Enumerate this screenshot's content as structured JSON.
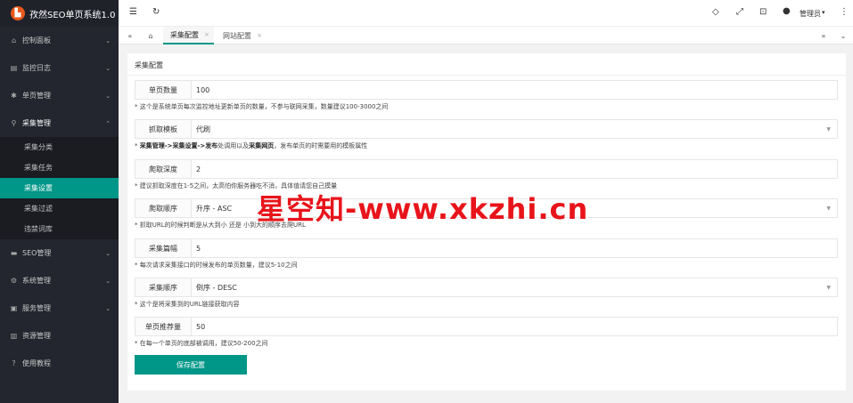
{
  "app": {
    "title": "孜然SEO单页系统1.0"
  },
  "sidebar": {
    "items": [
      {
        "label": "控制面板",
        "icon": "home-icon"
      },
      {
        "label": "监控日志",
        "icon": "log-icon"
      },
      {
        "label": "单页管理",
        "icon": "page-icon"
      },
      {
        "label": "采集管理",
        "icon": "link-icon"
      },
      {
        "label": "SEO管理",
        "icon": "seo-icon"
      },
      {
        "label": "系统管理",
        "icon": "gear-icon"
      },
      {
        "label": "服务管理",
        "icon": "server-icon"
      },
      {
        "label": "资源管理",
        "icon": "resource-icon"
      },
      {
        "label": "使用教程",
        "icon": "help-icon"
      }
    ],
    "subitems": [
      "采集分类",
      "采集任务",
      "采集设置",
      "采集过滤",
      "违禁词库"
    ]
  },
  "topbar": {
    "user": "管理员"
  },
  "tabs": [
    "采集配置",
    "网站配置"
  ],
  "panel": {
    "title": "采集配置",
    "rows": [
      {
        "label": "单页数量",
        "value": "100",
        "hint": "* 这个是系统单页每次监控地址更新单页的数量，不参与联网采集，数量建议100-3000之间"
      },
      {
        "label": "抓取模板",
        "value": "代刷",
        "hint_bold1": "采集管理->采集设置->发布",
        "hint_mid": "处调用以及",
        "hint_bold2": "采集网页",
        "hint_end": "，发布单页的时需要用的模板属性"
      },
      {
        "label": "爬取深度",
        "value": "2",
        "hint": "* 建议抓取深度在1-5之间，太高怕你服务器吃不消，具体值请您自己摸量"
      },
      {
        "label": "爬取顺序",
        "value": "升序 - ASC",
        "hint": "* 抓取URL的时候判断是从大到小 还是 小到大的顺序去爬URL"
      },
      {
        "label": "采集篇幅",
        "value": "5",
        "hint": "* 每次请求采集接口的时候发布的单页数量，建议5-10之间"
      },
      {
        "label": "采集顺序",
        "value": "倒序 - DESC",
        "hint": "* 这个是将采集到的URL链接获取内容"
      },
      {
        "label": "单页推荐量",
        "value": "50",
        "hint": "* 在每一个单页的底部被调用，建议50-200之间"
      }
    ],
    "save_label": "保存配置"
  },
  "watermark": "星空知-www.xkzhi.cn"
}
